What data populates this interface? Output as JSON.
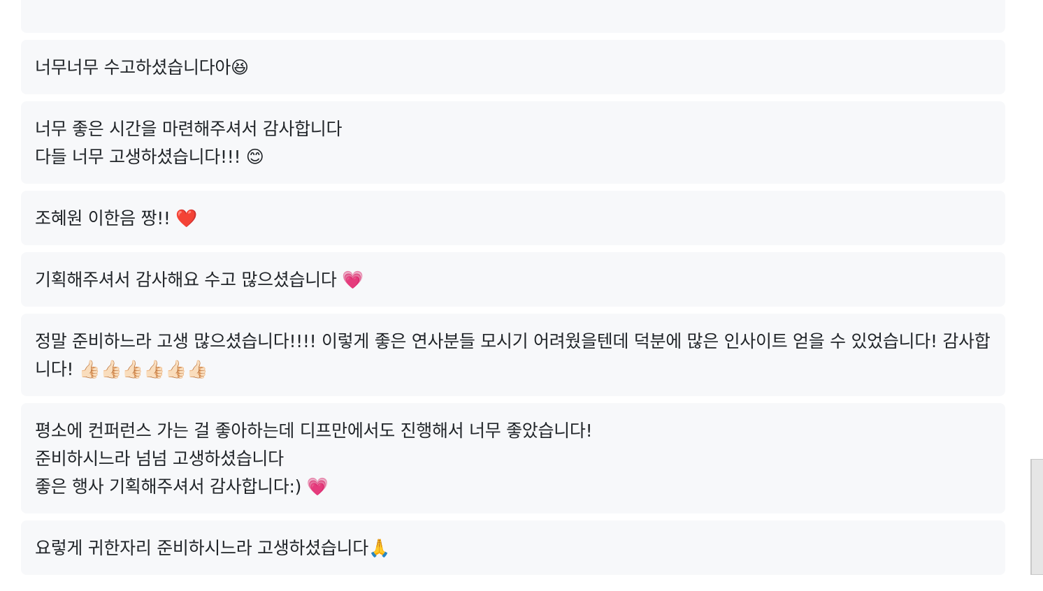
{
  "comments": [
    {
      "text": "너무너무 수고하셨습니다아😆"
    },
    {
      "text": "너무 좋은 시간을 마련해주셔서 감사합니다\n다들 너무 고생하셨습니다!!! 😊"
    },
    {
      "text": "조혜원 이한음 짱!! ❤️"
    },
    {
      "text": "기획해주셔서 감사해요 수고 많으셨습니다 💗"
    },
    {
      "text": "정말 준비하느라 고생 많으셨습니다!!!! 이렇게 좋은 연사분들 모시기 어려웠을텐데 덕분에 많은 인사이트 얻을 수 있었습니다! 감사합니다! 👍🏻👍🏻👍🏻👍🏻👍🏻👍🏻"
    },
    {
      "text": "평소에 컨퍼런스 가는 걸 좋아하는데 디프만에서도 진행해서 너무 좋았습니다!\n준비하시느라 넘넘 고생하셨습니다\n좋은 행사 기획해주셔서 감사합니다:) 💗"
    },
    {
      "text": "요렇게 귀한자리 준비하시느라 고생하셨습니다🙏"
    }
  ]
}
